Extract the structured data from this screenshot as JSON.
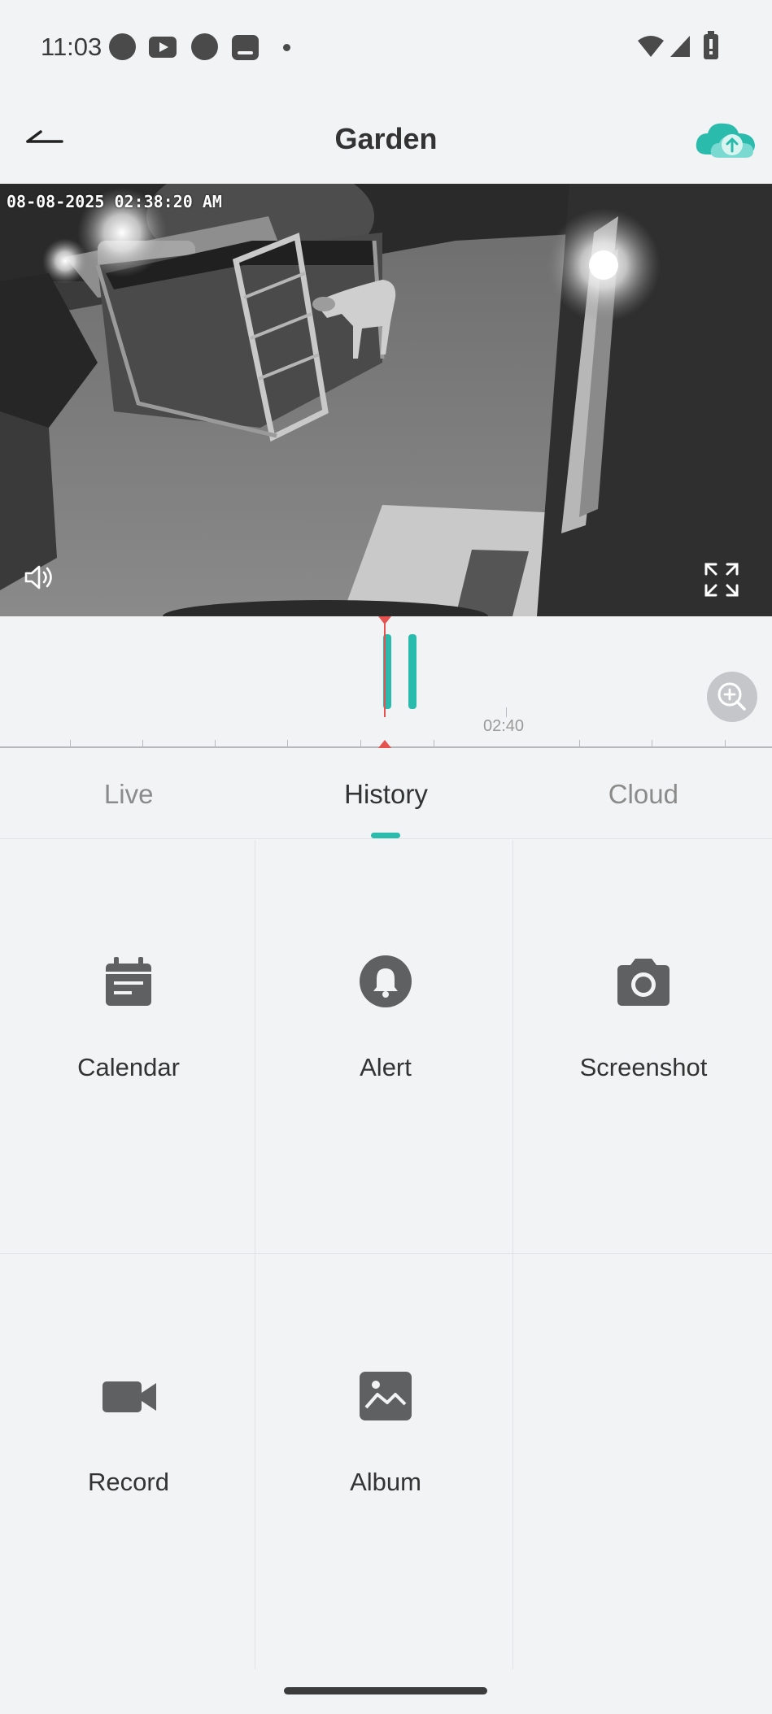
{
  "status_bar": {
    "time": "11:03",
    "icons": [
      "notification-dot-icon",
      "youtube-icon",
      "notification-dot-icon",
      "tablet-icon",
      "more-dot-icon",
      "wifi-icon",
      "cell-signal-icon",
      "battery-icon"
    ]
  },
  "header": {
    "back_icon": "back-arrow-icon",
    "title": "Garden",
    "cloud_icon": "cloud-upload-icon"
  },
  "video": {
    "timestamp": "08-08-2025 02:38:20 AM",
    "volume_icon": "volume-icon",
    "fullscreen_icon": "fullscreen-icon"
  },
  "timeline": {
    "label": "02:40",
    "zoom_icon": "zoom-in-icon",
    "accent_color": "#2bbbad",
    "cursor_color": "#e5524f"
  },
  "tabs": [
    {
      "label": "Live",
      "active": false
    },
    {
      "label": "History",
      "active": true
    },
    {
      "label": "Cloud",
      "active": false
    }
  ],
  "actions": [
    {
      "label": "Calendar",
      "icon": "calendar-icon"
    },
    {
      "label": "Alert",
      "icon": "bell-icon"
    },
    {
      "label": "Screenshot",
      "icon": "camera-icon"
    },
    {
      "label": "Record",
      "icon": "video-camera-icon"
    },
    {
      "label": "Album",
      "icon": "image-icon"
    }
  ]
}
